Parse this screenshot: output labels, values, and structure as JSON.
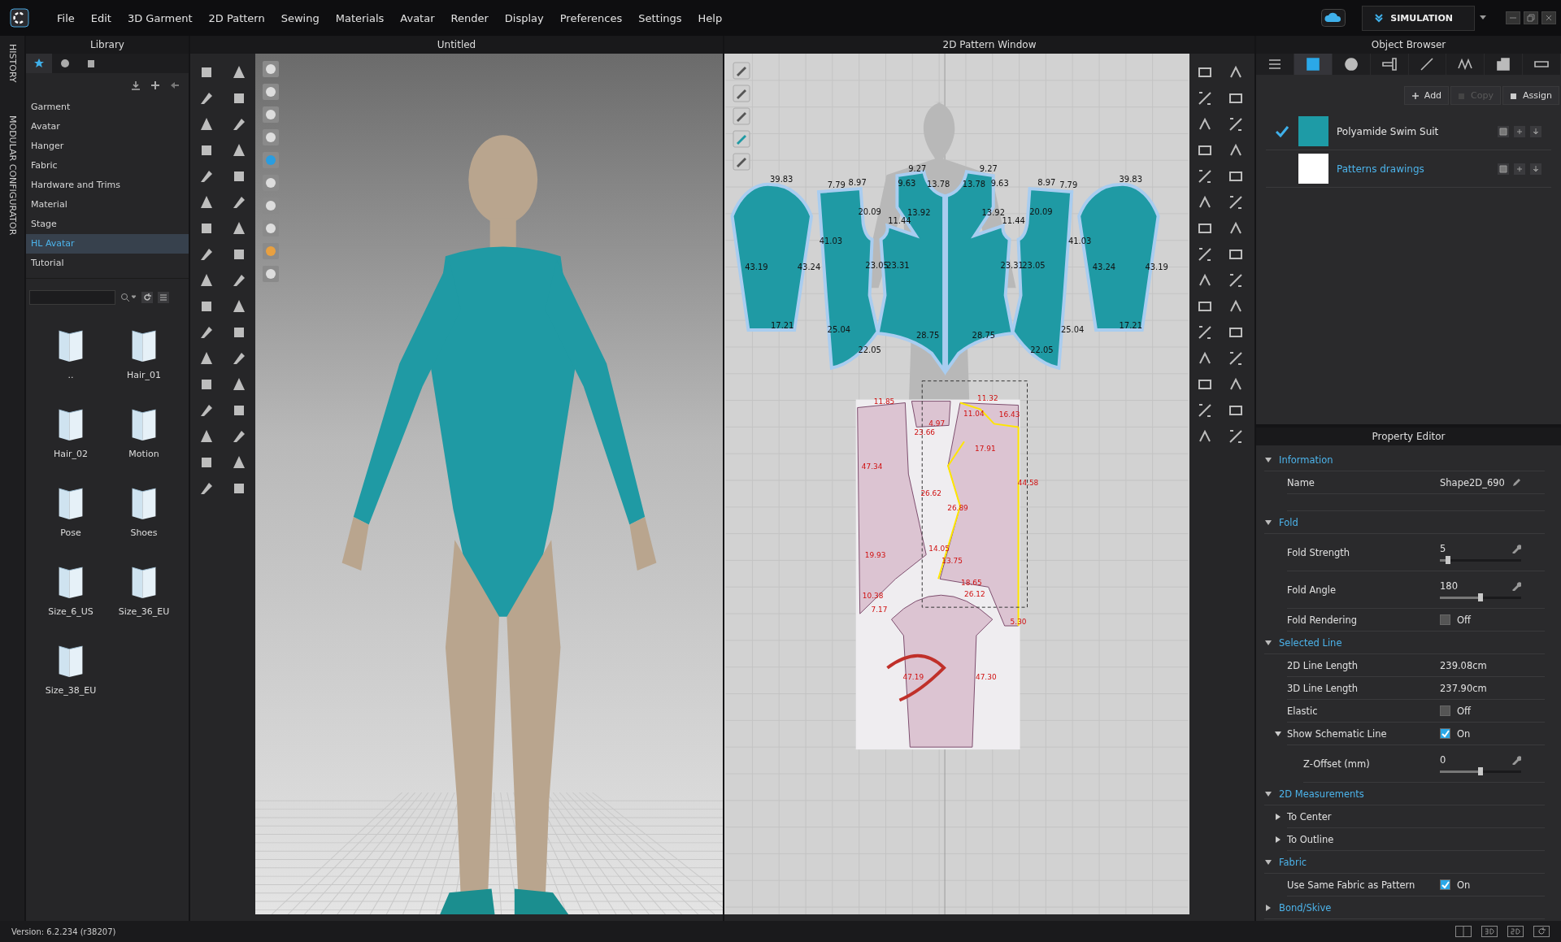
{
  "menu": {
    "items": [
      "File",
      "Edit",
      "3D Garment",
      "2D Pattern",
      "Sewing",
      "Materials",
      "Avatar",
      "Render",
      "Display",
      "Preferences",
      "Settings",
      "Help"
    ]
  },
  "mode": {
    "label": "SIMULATION"
  },
  "side_tabs": [
    {
      "label": "HISTORY",
      "selected": false
    },
    {
      "label": "MODULAR CONFIGURATOR",
      "selected": false
    }
  ],
  "library": {
    "title": "Library",
    "tabs": [
      {
        "selected": true
      },
      {
        "selected": false
      },
      {
        "selected": false
      }
    ],
    "categories": [
      {
        "label": "Garment",
        "selected": false
      },
      {
        "label": "Avatar",
        "selected": false
      },
      {
        "label": "Hanger",
        "selected": false
      },
      {
        "label": "Fabric",
        "selected": false
      },
      {
        "label": "Hardware and Trims",
        "selected": false
      },
      {
        "label": "Material",
        "selected": false
      },
      {
        "label": "Stage",
        "selected": false
      },
      {
        "label": "HL Avatar",
        "selected": true
      },
      {
        "label": "Tutorial",
        "selected": false
      }
    ],
    "files": [
      "..",
      "Hair_01",
      "Hair_02",
      "Motion",
      "Pose",
      "Shoes",
      "Size_6_US",
      "Size_36_EU",
      "Size_38_EU"
    ]
  },
  "viewport_3d": {
    "title": "Untitled"
  },
  "pattern_window": {
    "title": "2D Pattern Window",
    "measurements": [
      {
        "text": "39.83"
      },
      {
        "text": "7.79"
      },
      {
        "text": "8.97"
      },
      {
        "text": "9.27"
      },
      {
        "text": "9.63"
      },
      {
        "text": "13.78"
      },
      {
        "text": "20.09"
      },
      {
        "text": "13.92"
      },
      {
        "text": "11.44"
      },
      {
        "text": "41.03"
      },
      {
        "text": "43.19"
      },
      {
        "text": "43.24"
      },
      {
        "text": "23.05"
      },
      {
        "text": "23.31"
      },
      {
        "text": "17.21"
      },
      {
        "text": "25.04"
      },
      {
        "text": "28.75"
      },
      {
        "text": "22.05"
      },
      {
        "text": "9.27"
      },
      {
        "text": "13.78"
      },
      {
        "text": "9.63"
      },
      {
        "text": "8.97"
      },
      {
        "text": "7.79"
      },
      {
        "text": "39.83"
      },
      {
        "text": "13.92"
      },
      {
        "text": "11.44"
      },
      {
        "text": "20.09"
      },
      {
        "text": "41.03"
      },
      {
        "text": "23.31"
      },
      {
        "text": "23.05"
      },
      {
        "text": "43.24"
      },
      {
        "text": "43.19"
      },
      {
        "text": "17.21"
      },
      {
        "text": "25.04"
      },
      {
        "text": "28.75"
      },
      {
        "text": "22.05"
      }
    ],
    "overlay_measurements": [
      {
        "text": "11.85"
      },
      {
        "text": "11.32"
      },
      {
        "text": "11.04"
      },
      {
        "text": "16.43"
      },
      {
        "text": "23.66"
      },
      {
        "text": "47.34"
      },
      {
        "text": "17.91"
      },
      {
        "text": "44.58"
      },
      {
        "text": "26.62"
      },
      {
        "text": "26.89"
      },
      {
        "text": "19.93"
      },
      {
        "text": "14.05"
      },
      {
        "text": "13.75"
      },
      {
        "text": "10.38"
      },
      {
        "text": "18.65"
      },
      {
        "text": "26.12"
      },
      {
        "text": "7.17"
      },
      {
        "text": "5.30"
      },
      {
        "text": "47.19"
      },
      {
        "text": "47.30"
      },
      {
        "text": "4.97"
      }
    ]
  },
  "object_browser": {
    "title": "Object Browser",
    "tabs": [
      {
        "selected": false
      },
      {
        "selected": true
      },
      {
        "selected": false
      },
      {
        "selected": false
      },
      {
        "selected": false
      },
      {
        "selected": false
      },
      {
        "selected": false
      },
      {
        "selected": false
      }
    ],
    "buttons": [
      {
        "label": "Add",
        "disabled": false
      },
      {
        "label": "Copy",
        "disabled": true
      },
      {
        "label": "Assign",
        "disabled": false
      }
    ],
    "items": [
      {
        "name": "Polyamide Swim Suit",
        "checked": true,
        "selected": false,
        "color": "#1e9ba6"
      },
      {
        "name": "Patterns drawings",
        "checked": false,
        "selected": true,
        "color": "#ffffff"
      }
    ]
  },
  "property_editor": {
    "title": "Property Editor",
    "sections": [
      {
        "title": "Information",
        "expanded": true,
        "rows": [
          {
            "kind": "text",
            "label": "Name",
            "value": "Shape2D_690"
          },
          {
            "kind": "blank"
          }
        ]
      },
      {
        "title": "Fold",
        "expanded": true,
        "rows": [
          {
            "kind": "slider",
            "label": "Fold Strength",
            "value": "5",
            "level": 0.1
          },
          {
            "kind": "slider",
            "label": "Fold Angle",
            "value": "180",
            "level": 0.5
          },
          {
            "kind": "toggle",
            "label": "Fold Rendering",
            "checked": false,
            "value": "Off"
          }
        ]
      },
      {
        "title": "Selected Line",
        "expanded": true,
        "rows": [
          {
            "kind": "text",
            "label": "2D Line Length",
            "value": "239.08cm"
          },
          {
            "kind": "text",
            "label": "3D Line Length",
            "value": "237.90cm"
          },
          {
            "kind": "toggle",
            "label": "Elastic",
            "checked": false,
            "value": "Off"
          },
          {
            "kind": "toggle",
            "label": "Show Schematic Line",
            "checked": true,
            "value": "On",
            "expanded": true,
            "children": [
              {
                "kind": "slider",
                "label": "Z-Offset (mm)",
                "value": "0",
                "level": 0.5
              }
            ]
          }
        ]
      },
      {
        "title": "2D Measurements",
        "expanded": true,
        "rows": [
          {
            "kind": "group",
            "label": "To Center",
            "expanded": false
          },
          {
            "kind": "group",
            "label": "To Outline",
            "expanded": false
          }
        ]
      },
      {
        "title": "Fabric",
        "expanded": true,
        "rows": [
          {
            "kind": "toggle",
            "label": "Use Same Fabric as Pattern",
            "checked": true,
            "value": "On"
          }
        ]
      },
      {
        "title": "Bond/Skive",
        "expanded": false
      }
    ]
  },
  "status_bar": {
    "version": "Version: 6.2.234 (r38207)"
  }
}
